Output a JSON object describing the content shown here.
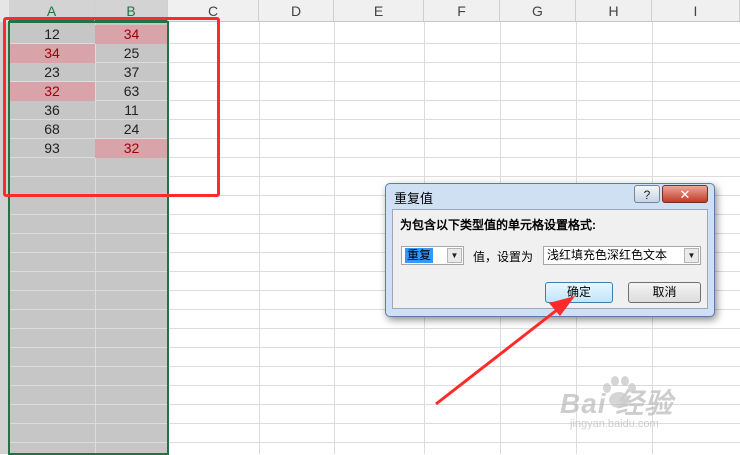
{
  "spreadsheet": {
    "columns": [
      "A",
      "B",
      "C",
      "D",
      "E",
      "F",
      "G",
      "H",
      "I"
    ],
    "selected_columns": [
      "A",
      "B"
    ],
    "cells": {
      "A": [
        "12",
        "34",
        "23",
        "32",
        "36",
        "68",
        "93"
      ],
      "B": [
        "34",
        "25",
        "37",
        "63",
        "11",
        "24",
        "32"
      ]
    },
    "duplicate_highlight": {
      "A": [
        false,
        true,
        false,
        true,
        false,
        false,
        false
      ],
      "B": [
        true,
        false,
        false,
        false,
        false,
        false,
        true
      ]
    },
    "duplicate_fill_color": "#d8a3a9",
    "duplicate_text_color": "#9c0006",
    "selection_color": "#217346"
  },
  "annotation": {
    "box_color": "#ff2a2a",
    "arrow_color": "#ff2a2a"
  },
  "dialog": {
    "title": "重复值",
    "help_label": "?",
    "close_label": "✕",
    "prompt": "为包含以下类型值的单元格设置格式:",
    "type_select_value": "重复",
    "value_label": "值，设置为",
    "format_select_value": "浅红填充色深红色文本",
    "ok_label": "确定",
    "cancel_label": "取消"
  },
  "watermark": {
    "brand": "Bai  经验",
    "url": "jingyan.baidu.com"
  }
}
